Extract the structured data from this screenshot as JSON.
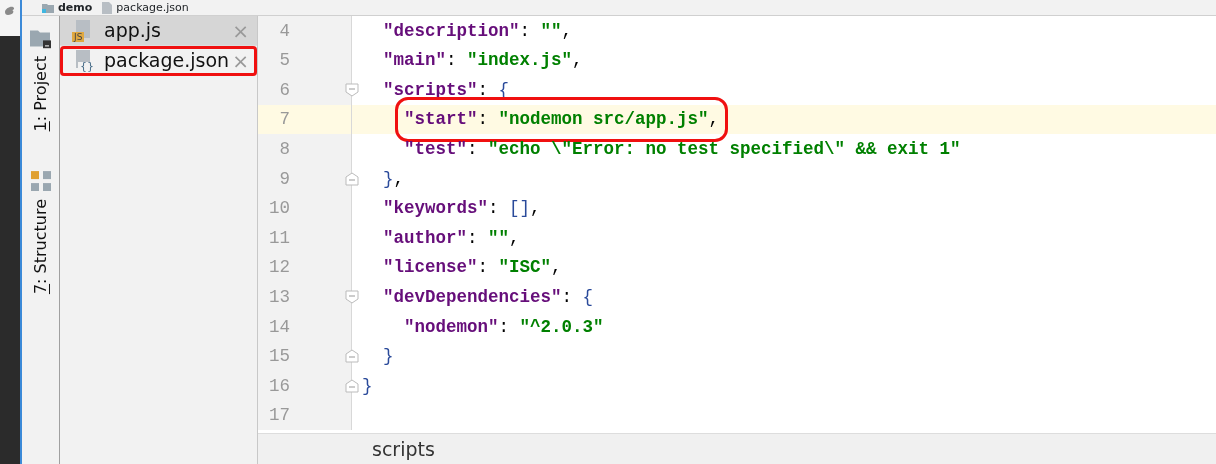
{
  "breadcrumb": [
    {
      "label": "demo",
      "kind": "folder"
    },
    {
      "label": "package.json",
      "kind": "json"
    }
  ],
  "tool_stripe": [
    {
      "mnemonic": "1",
      "label": ": Project",
      "kind": "project"
    },
    {
      "mnemonic": "7",
      "label": ": Structure",
      "kind": "structure"
    }
  ],
  "open_files": [
    {
      "label": "app.js",
      "kind": "js",
      "badge": "JS",
      "close": "×",
      "selected": true,
      "annotated": false
    },
    {
      "label": "package.json",
      "kind": "json",
      "badge": "{}",
      "close": "×",
      "selected": false,
      "annotated": true
    }
  ],
  "editor": {
    "lines": [
      {
        "number": "4",
        "kind": "plain",
        "caret": false,
        "annotated": false,
        "tokens": [
          {
            "kind": "key",
            "text": "\"description\""
          },
          {
            "kind": "punct",
            "text": ": "
          },
          {
            "kind": "string",
            "text": "\"\""
          },
          {
            "kind": "punct",
            "text": ","
          }
        ]
      },
      {
        "number": "5",
        "kind": "plain",
        "caret": false,
        "annotated": false,
        "tokens": [
          {
            "kind": "key",
            "text": "\"main\""
          },
          {
            "kind": "punct",
            "text": ": "
          },
          {
            "kind": "string",
            "text": "\"index.js\""
          },
          {
            "kind": "punct",
            "text": ","
          }
        ]
      },
      {
        "number": "6",
        "kind": "opener",
        "caret": false,
        "annotated": false,
        "tokens": [
          {
            "kind": "key",
            "text": "\"scripts\""
          },
          {
            "kind": "punct",
            "text": ": "
          },
          {
            "kind": "open_brace",
            "text": "{"
          }
        ]
      },
      {
        "number": "7",
        "kind": "plain",
        "caret": true,
        "annotated": true,
        "tokens": [
          {
            "kind": "key",
            "text": "\"start\""
          },
          {
            "kind": "punct",
            "text": ": "
          },
          {
            "kind": "string",
            "text": "\"nodemon src/app.js\""
          },
          {
            "kind": "punct",
            "text": ","
          }
        ]
      },
      {
        "number": "8",
        "kind": "plain",
        "caret": false,
        "annotated": false,
        "tokens": [
          {
            "kind": "key",
            "text": "\"test\""
          },
          {
            "kind": "punct",
            "text": ": "
          },
          {
            "kind": "string",
            "text": "\"echo \\\"Error: no test specified\\\" && exit 1\""
          }
        ]
      },
      {
        "number": "9",
        "kind": "closer",
        "caret": false,
        "annotated": false,
        "tokens": [
          {
            "kind": "close_brace",
            "text": "}"
          },
          {
            "kind": "punct",
            "text": ","
          }
        ]
      },
      {
        "number": "10",
        "kind": "plain",
        "caret": false,
        "annotated": false,
        "tokens": [
          {
            "kind": "key",
            "text": "\"keywords\""
          },
          {
            "kind": "punct",
            "text": ": "
          },
          {
            "kind": "bracket",
            "text": "[]"
          },
          {
            "kind": "punct",
            "text": ","
          }
        ]
      },
      {
        "number": "11",
        "kind": "plain",
        "caret": false,
        "annotated": false,
        "tokens": [
          {
            "kind": "key",
            "text": "\"author\""
          },
          {
            "kind": "punct",
            "text": ": "
          },
          {
            "kind": "string",
            "text": "\"\""
          },
          {
            "kind": "punct",
            "text": ","
          }
        ]
      },
      {
        "number": "12",
        "kind": "plain",
        "caret": false,
        "annotated": false,
        "tokens": [
          {
            "kind": "key",
            "text": "\"license\""
          },
          {
            "kind": "punct",
            "text": ": "
          },
          {
            "kind": "string",
            "text": "\"ISC\""
          },
          {
            "kind": "punct",
            "text": ","
          }
        ]
      },
      {
        "number": "13",
        "kind": "opener",
        "caret": false,
        "annotated": false,
        "tokens": [
          {
            "kind": "key",
            "text": "\"devDependencies\""
          },
          {
            "kind": "punct",
            "text": ": "
          },
          {
            "kind": "open_brace",
            "text": "{"
          }
        ]
      },
      {
        "number": "14",
        "kind": "plain",
        "caret": false,
        "annotated": false,
        "tokens": [
          {
            "kind": "key",
            "text": "\"nodemon\""
          },
          {
            "kind": "punct",
            "text": ": "
          },
          {
            "kind": "string",
            "text": "\"^2.0.3\""
          }
        ]
      },
      {
        "number": "15",
        "kind": "closer",
        "caret": false,
        "annotated": false,
        "tokens": [
          {
            "kind": "close_brace",
            "text": "}"
          }
        ]
      },
      {
        "number": "16",
        "kind": "closer",
        "caret": false,
        "annotated": false,
        "tokens": [
          {
            "kind": "close_brace",
            "text": "}"
          }
        ]
      },
      {
        "number": "17",
        "kind": "plain",
        "caret": false,
        "annotated": false
      }
    ]
  },
  "status_bar": {
    "breadcrumb": "scripts"
  }
}
